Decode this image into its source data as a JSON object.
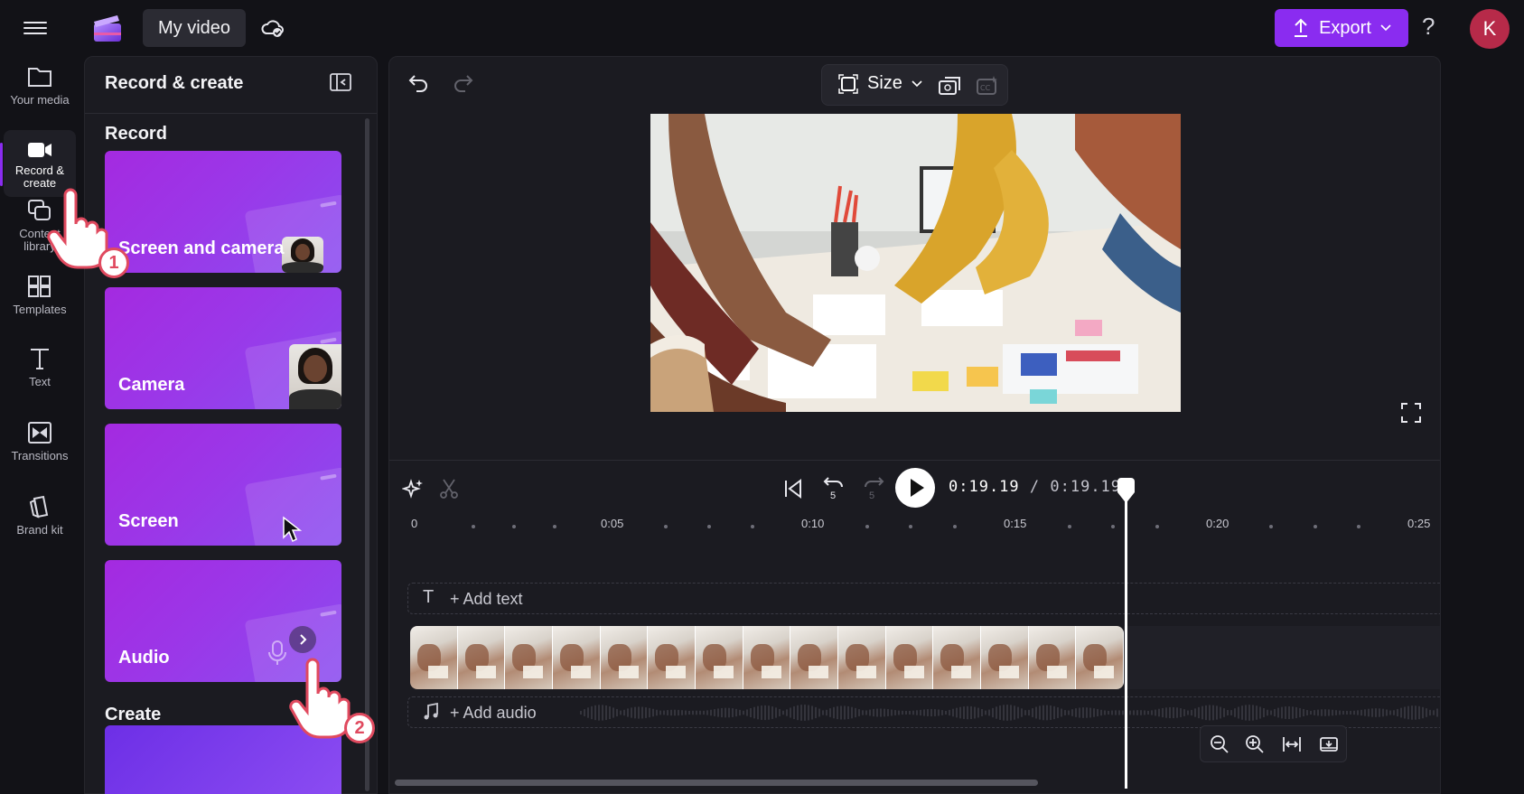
{
  "header": {
    "project_name": "My video",
    "export_label": "Export",
    "help_label": "?",
    "avatar_initial": "K"
  },
  "rail": {
    "items": [
      {
        "label_line1": "Your media",
        "label_line2": "",
        "icon": "folder-icon"
      },
      {
        "label_line1": "Record &",
        "label_line2": "create",
        "icon": "camera-icon"
      },
      {
        "label_line1": "Content",
        "label_line2": "library",
        "icon": "content-library-icon"
      },
      {
        "label_line1": "Templates",
        "label_line2": "",
        "icon": "templates-icon"
      },
      {
        "label_line1": "Text",
        "label_line2": "",
        "icon": "text-icon"
      },
      {
        "label_line1": "Transitions",
        "label_line2": "",
        "icon": "transitions-icon"
      },
      {
        "label_line1": "Brand kit",
        "label_line2": "",
        "icon": "brand-kit-icon"
      }
    ]
  },
  "panel": {
    "title": "Record & create",
    "record_label": "Record",
    "create_label": "Create",
    "cards": [
      {
        "label": "Screen and camera"
      },
      {
        "label": "Camera"
      },
      {
        "label": "Screen"
      },
      {
        "label": "Audio"
      }
    ]
  },
  "toolbar": {
    "size_label": "Size"
  },
  "playback": {
    "current_time": "0:19.19",
    "total_time": "/ 0:19.19",
    "rewind_label": "5",
    "forward_label": "5"
  },
  "timeline": {
    "ticks": [
      "0",
      "0:05",
      "0:10",
      "0:15",
      "0:20",
      "0:25"
    ],
    "add_text_label": "+ Add text",
    "add_audio_label": "+ Add audio",
    "text_track_icon": "T"
  },
  "annotations": {
    "step1": "1",
    "step2": "2"
  },
  "colors": {
    "accent": "#8a2cf0",
    "avatar": "#b72a49",
    "badge_border": "#e04a5f",
    "background": "#121217",
    "panel": "#1b1b21"
  }
}
